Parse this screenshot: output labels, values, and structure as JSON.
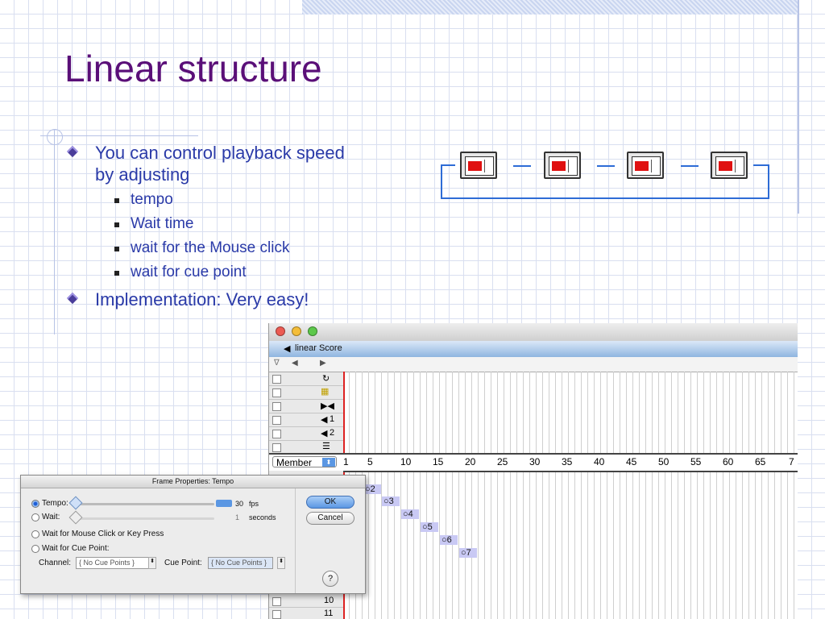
{
  "slide": {
    "title": "Linear structure",
    "bullets": [
      {
        "text_line1": "You can control playback speed",
        "text_line2": "by adjusting",
        "sub": [
          "tempo",
          "Wait time",
          "wait for the Mouse click",
          "wait for cue point"
        ]
      },
      {
        "text": "Implementation: Very easy!"
      }
    ]
  },
  "colors": {
    "title": "#5a0f78",
    "bullet_text": "#2a3aa8",
    "arrow": "#2e6cd6"
  },
  "score": {
    "window_title": "linear Score",
    "channel_member_label": "Member",
    "sprite_channels": [
      "1",
      "2"
    ],
    "ruler": [
      "1",
      "5",
      "10",
      "15",
      "20",
      "25",
      "30",
      "35",
      "40",
      "45",
      "50",
      "55",
      "60",
      "65",
      "7"
    ],
    "cells": [
      "2",
      "3",
      "4",
      "5",
      "6",
      "7"
    ],
    "row_numbers": [
      "10",
      "11"
    ]
  },
  "dialog": {
    "title": "Frame Properties: Tempo",
    "tempo_label": "Tempo:",
    "tempo_value": "30",
    "tempo_unit": "fps",
    "wait_label": "Wait:",
    "wait_value": "1",
    "wait_unit": "seconds",
    "mouse_label": "Wait for Mouse Click or Key Press",
    "cue_label": "Wait for Cue Point:",
    "channel_label": "Channel:",
    "channel_value": "{ No Cue Points }",
    "cuepoint_label": "Cue Point:",
    "cuepoint_value": "{ No Cue Points }",
    "ok": "OK",
    "cancel": "Cancel",
    "help": "?"
  }
}
